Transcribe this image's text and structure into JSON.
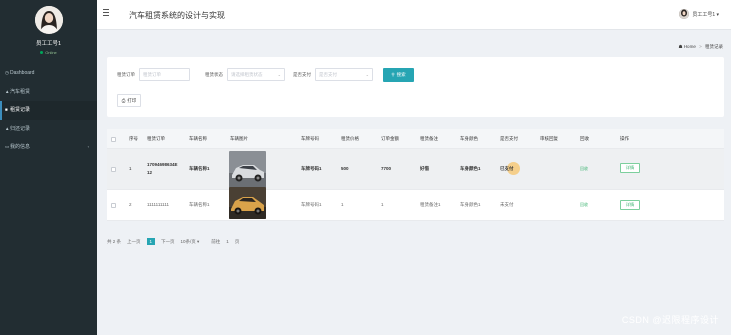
{
  "sidebar": {
    "user_name": "员工工号1",
    "status": "Online",
    "items": [
      {
        "label": "Dashboard",
        "icon": "dashboard-icon",
        "glyph": "◷"
      },
      {
        "label": "汽车租赁",
        "icon": "car-icon",
        "glyph": "▲"
      },
      {
        "label": "租赁记录",
        "icon": "list-icon",
        "glyph": "■"
      },
      {
        "label": "归还记录",
        "icon": "user-icon",
        "glyph": "▲"
      },
      {
        "label": "我的信息",
        "icon": "info-icon",
        "glyph": "▭"
      }
    ]
  },
  "header": {
    "title": "汽车租赁系统的设计与实现",
    "user": "员工工号1 ▾"
  },
  "breadcrumb": {
    "home": "Home",
    "separator": ">",
    "current": "租赁记录"
  },
  "search": {
    "order_label": "租赁订单",
    "order_placeholder": "租赁订单",
    "status_label": "租赁状态",
    "status_placeholder": "请选择租赁状态",
    "pay_label": "是否支付",
    "pay_placeholder": "是否支付",
    "search_button": "搜索",
    "print_button": "打印"
  },
  "table": {
    "columns": [
      "序号",
      "租赁订单",
      "车辆名称",
      "车辆图片",
      "车牌号码",
      "租赁价格",
      "订单金额",
      "租赁备注",
      "车身颜色",
      "是否支付",
      "审核回复",
      "回收",
      "操作"
    ],
    "rows": [
      {
        "index": "1",
        "order_line1": "17094698634E",
        "order_line2": "12",
        "car_name": "车辆名称1",
        "plate": "车牌号码1",
        "price": "500",
        "amount": "7700",
        "remark": "好借",
        "color": "车身颜色1",
        "paid": "已支付",
        "reply": "",
        "status": "回收",
        "action": "详情"
      },
      {
        "index": "2",
        "order_line1": "1111111111",
        "order_line2": "",
        "car_name": "车辆名称1",
        "plate": "车牌号码1",
        "price": "1",
        "amount": "1",
        "remark": "租赁备注1",
        "color": "车身颜色1",
        "paid": "未支付",
        "reply": "",
        "status": "回收",
        "action": "详情"
      }
    ]
  },
  "pagination": {
    "total": "共 2 条",
    "prev": "上一页",
    "current": "1",
    "next": "下一页",
    "per_page": "10条/页 ▾",
    "goto": "前往",
    "goto_page": "1",
    "page_suffix": "页"
  },
  "watermark": "CSDN @迟限程序设计",
  "colors": {
    "accent": "#26a5b3",
    "sidebar": "#222d32",
    "green": "#3cb371"
  }
}
